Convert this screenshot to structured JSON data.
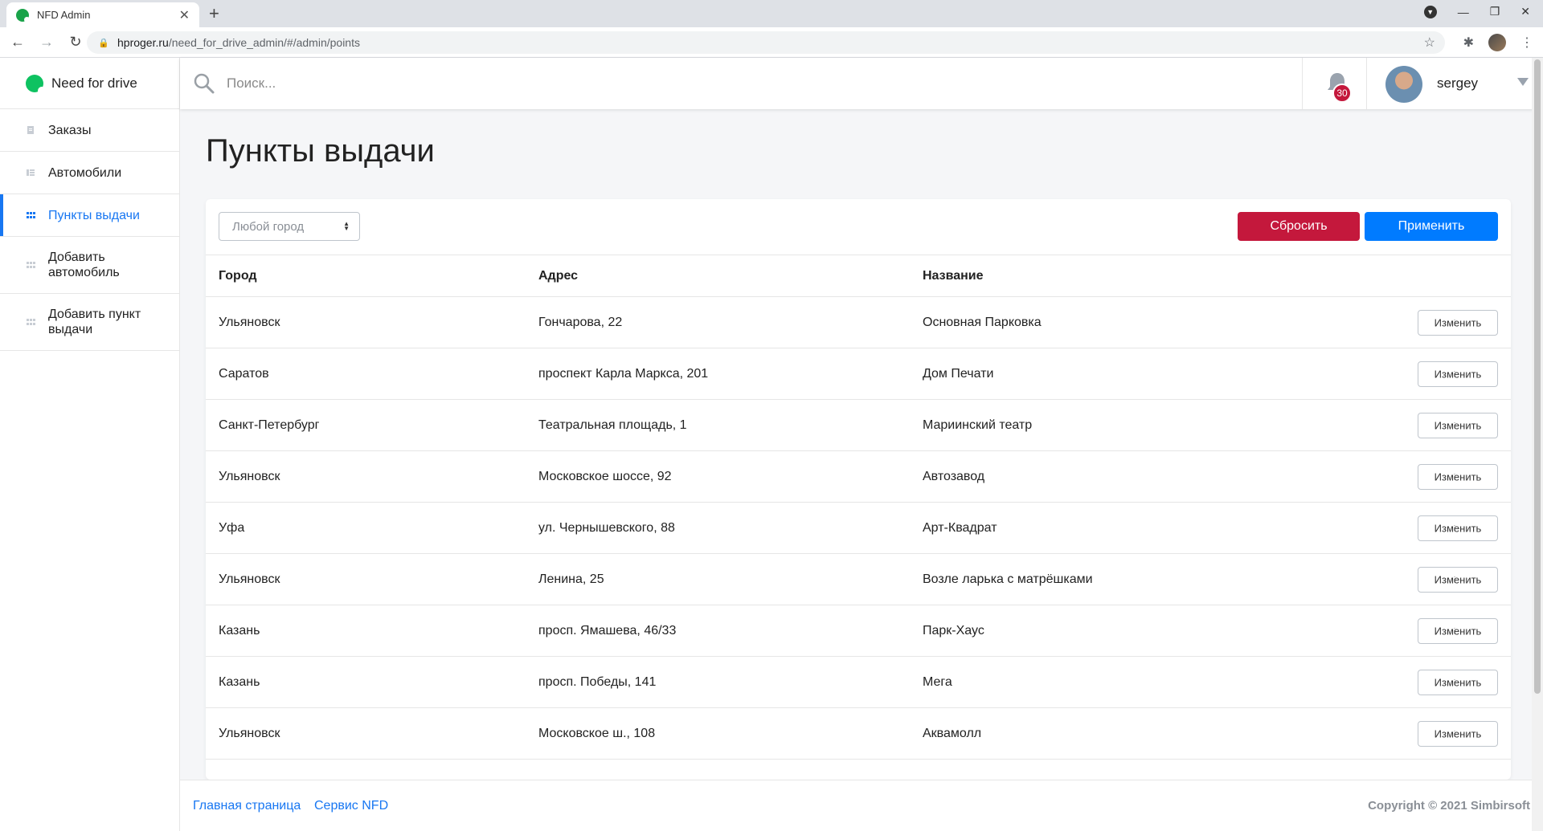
{
  "browser": {
    "tab_title": "NFD Admin",
    "url_host": "hproger.ru",
    "url_path": "/need_for_drive_admin/#/admin/points"
  },
  "sidebar": {
    "brand": "Need for drive",
    "items": [
      {
        "label": "Заказы",
        "icon": "document-icon",
        "active": false
      },
      {
        "label": "Автомобили",
        "icon": "car-list-icon",
        "active": false
      },
      {
        "label": "Пункты выдачи",
        "icon": "grid-icon",
        "active": true
      },
      {
        "label": "Добавить автомобиль",
        "icon": "grid-icon",
        "active": false
      },
      {
        "label": "Добавить пункт выдачи",
        "icon": "grid-icon",
        "active": false
      }
    ]
  },
  "header": {
    "search_placeholder": "Поиск...",
    "notifications_count": "30",
    "username": "sergey"
  },
  "page": {
    "title": "Пункты выдачи"
  },
  "filters": {
    "city_select": "Любой город",
    "reset_label": "Сбросить",
    "apply_label": "Применить"
  },
  "table": {
    "columns": [
      "Город",
      "Адрес",
      "Название"
    ],
    "edit_label": "Изменить",
    "rows": [
      [
        "Ульяновск",
        "Гончарова, 22",
        "Основная Парковка"
      ],
      [
        "Саратов",
        "проспект Карла Маркса, 201",
        "Дом Печати"
      ],
      [
        "Санкт-Петербург",
        "Театральная площадь, 1",
        "Мариинский театр"
      ],
      [
        "Ульяновск",
        "Московское шоссе, 92",
        "Автозавод"
      ],
      [
        "Уфа",
        "ул. Чернышевского, 88",
        "Арт-Квадрат"
      ],
      [
        "Ульяновск",
        "Ленина, 25",
        "Возле ларька с матрёшками"
      ],
      [
        "Казань",
        "просп. Ямашева, 46/33",
        "Парк-Хаус"
      ],
      [
        "Казань",
        "просп. Победы, 141",
        "Мега"
      ],
      [
        "Ульяновск",
        "Московское ш., 108",
        "Аквамолл"
      ]
    ]
  },
  "footer": {
    "link_home": "Главная страница",
    "link_service": "Сервис NFD",
    "copyright": "Copyright © 2021 Simbirsoft"
  },
  "colors": {
    "accent": "#1877f2",
    "danger": "#c4183c",
    "primary": "#007bff",
    "brand_green": "#0ec261"
  }
}
